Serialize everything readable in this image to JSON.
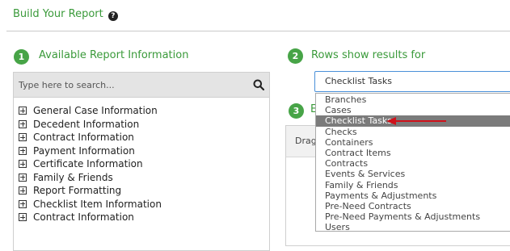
{
  "header": {
    "title": "Build Your Report",
    "help_icon": "?"
  },
  "step1": {
    "number": "1",
    "title": "Available Report Information",
    "search_placeholder": "Type here to search...",
    "items": [
      "General Case Information",
      "Decedent Information",
      "Contract Information",
      "Payment Information",
      "Certificate Information",
      "Family & Friends",
      "Report Formatting",
      "Checklist Item Information",
      "Contract Information"
    ]
  },
  "step2": {
    "number": "2",
    "title": "Rows show results for",
    "selected": "Checklist Tasks",
    "options": [
      "Branches",
      "Cases",
      "Checklist Tasks",
      "Checks",
      "Containers",
      "Contract Items",
      "Contracts",
      "Events & Services",
      "Family & Friends",
      "Payments & Adjustments",
      "Pre-Need Contracts",
      "Pre-Need Payments & Adjustments",
      "Users"
    ],
    "selected_index": 2
  },
  "step3": {
    "number": "3",
    "title_visible": "E",
    "drag_text": "Drag"
  },
  "colors": {
    "accent_green": "#3a9a3a",
    "badge_green": "#47a447",
    "highlight": "#7b7b7b",
    "arrow_red": "#d0121b"
  }
}
